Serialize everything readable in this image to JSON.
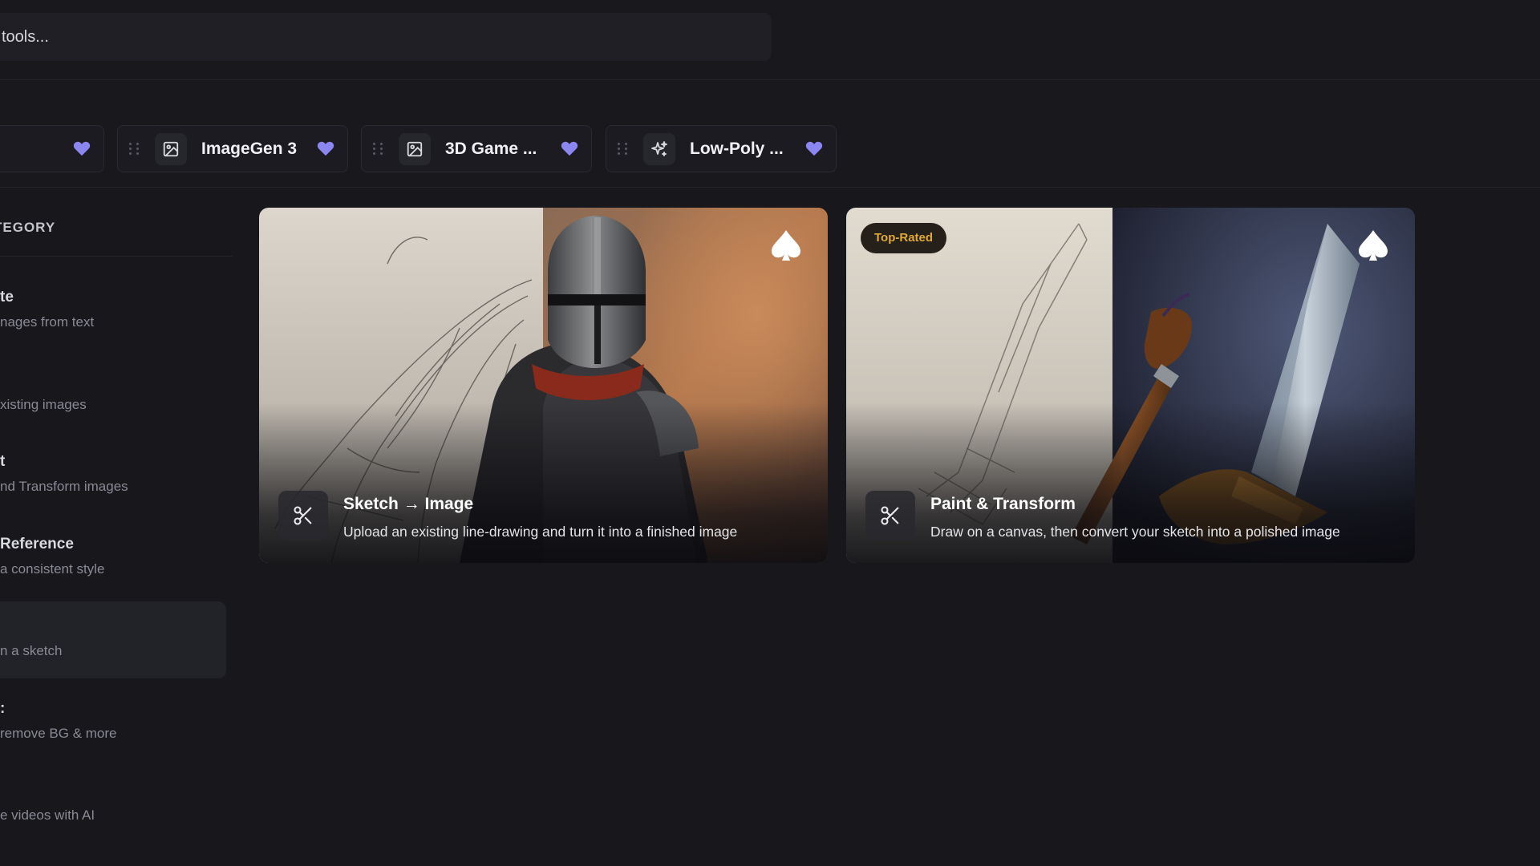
{
  "search": {
    "placeholder": "tools..."
  },
  "favorites": [
    {
      "label": "",
      "icon": "image-icon"
    },
    {
      "label": "ImageGen 3",
      "icon": "image-icon"
    },
    {
      "label": "3D Game ...",
      "icon": "image-icon"
    },
    {
      "label": "Low-Poly ...",
      "icon": "sparkle-icon"
    }
  ],
  "sidebar": {
    "header": "TEGORY",
    "items": [
      {
        "title": "te",
        "desc": "nages from text"
      },
      {
        "title": "",
        "desc": "xisting images"
      },
      {
        "title": "t",
        "desc": "nd Transform images"
      },
      {
        "title": "Reference",
        "desc": " a consistent style"
      },
      {
        "title": "",
        "desc": "n a sketch"
      },
      {
        "title": ":",
        "desc": "remove BG & more"
      },
      {
        "title": "",
        "desc": "e videos with AI"
      }
    ]
  },
  "cards": [
    {
      "title": "Sketch → Image",
      "desc": "Upload an existing line-drawing and turn it into a finished image",
      "icon": "scissors-icon"
    },
    {
      "title": "Paint & Transform",
      "desc": "Draw on a canvas, then convert your sketch into a polished image",
      "badge": "Top-Rated",
      "icon": "scissors-icon"
    }
  ],
  "colors": {
    "background": "#17171c",
    "heart": "#8b86f0",
    "badge_text": "#e0a836"
  }
}
